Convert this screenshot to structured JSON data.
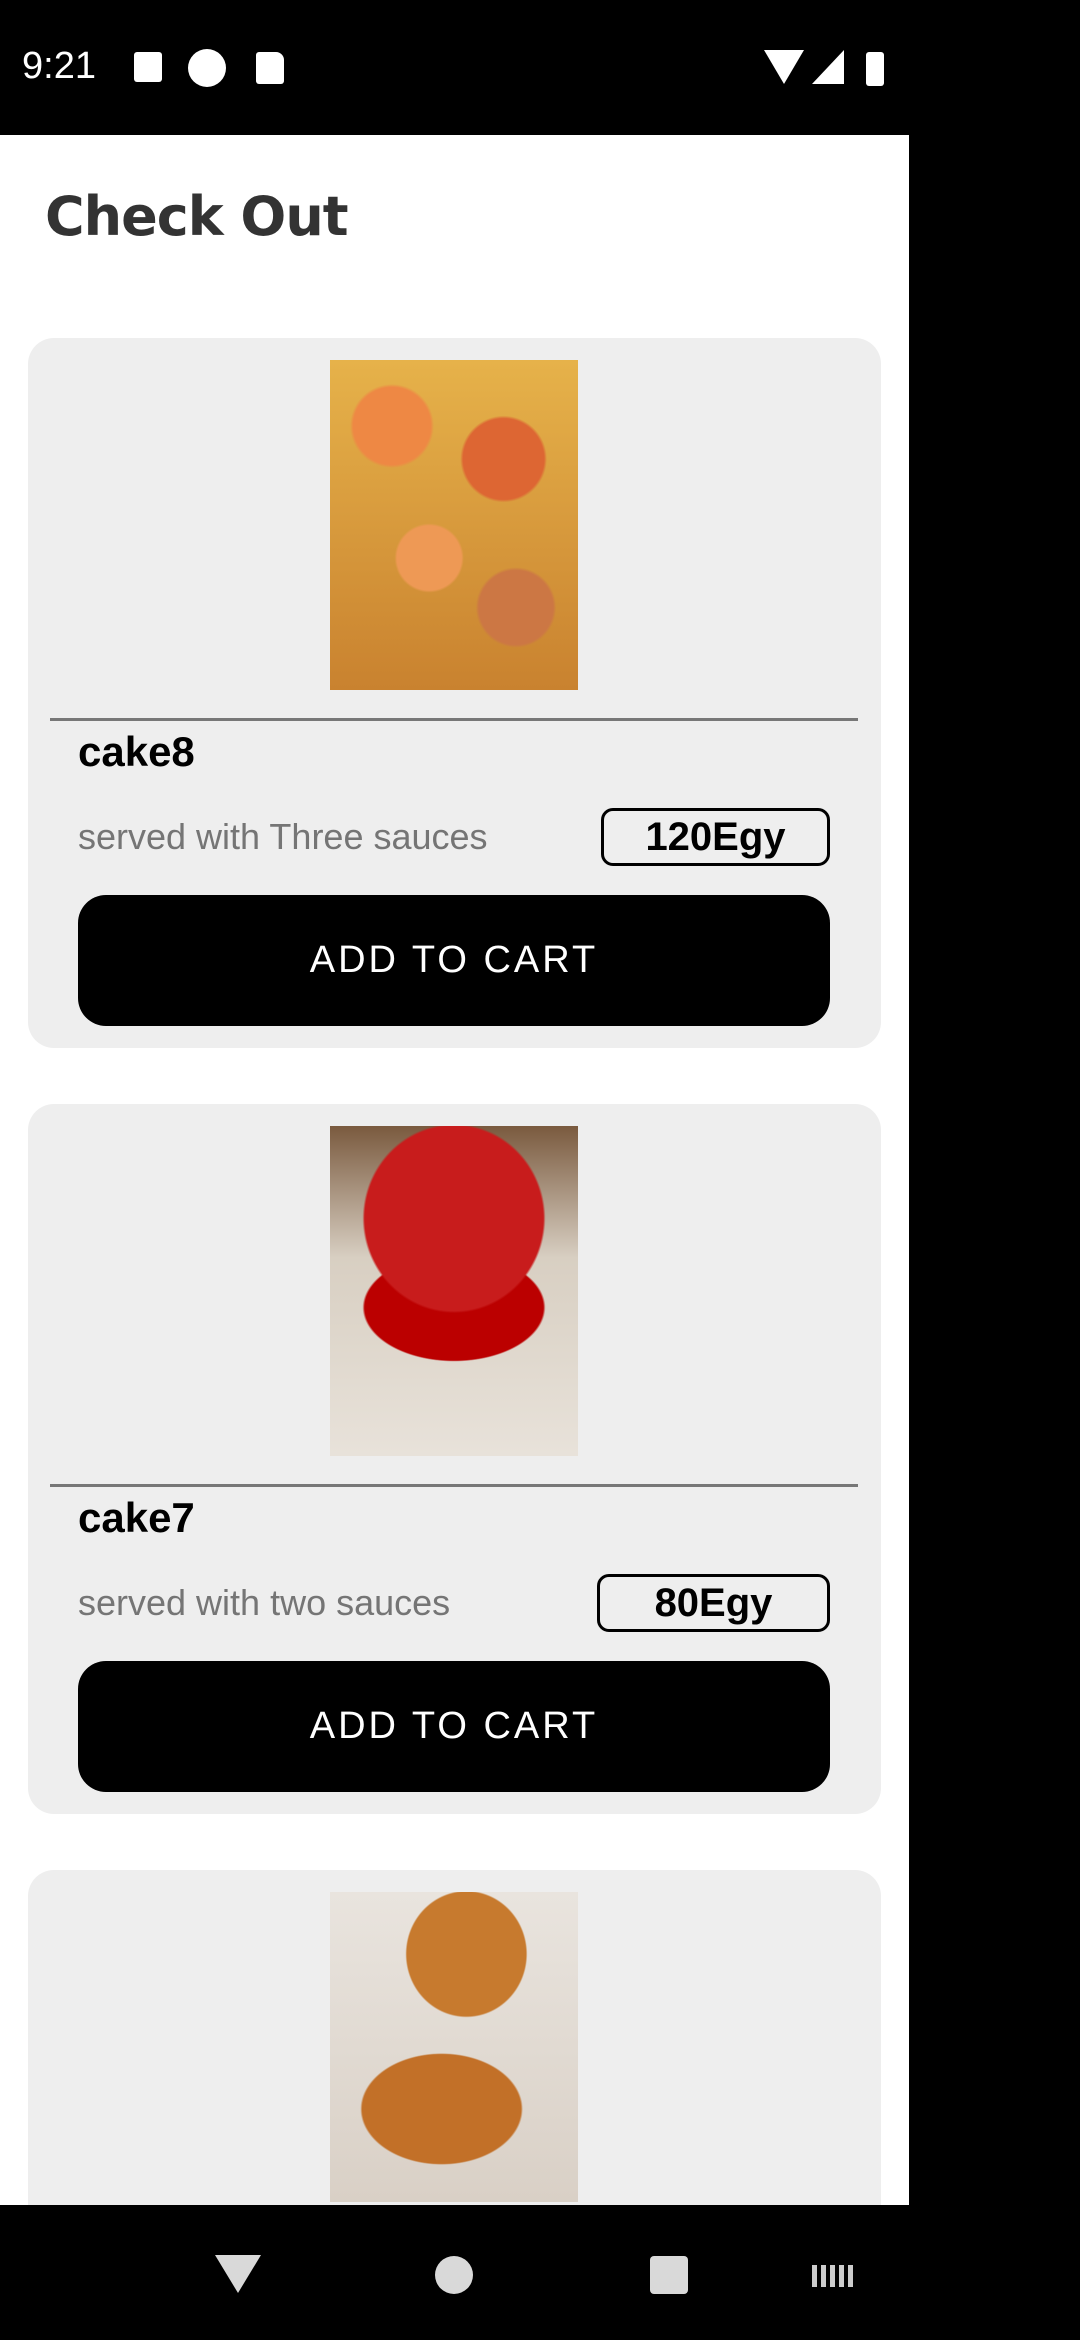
{
  "status_bar": {
    "time": "9:21"
  },
  "header": {
    "title": "Check Out"
  },
  "products": [
    {
      "name": "cake8",
      "description": "served with Three sauces",
      "price": "120Egy",
      "button": "ADD TO CART",
      "image": "pizza-pastries"
    },
    {
      "name": "cake7",
      "description": "served with two sauces",
      "price": "80Egy",
      "button": "ADD TO CART",
      "image": "strawberry-cake"
    },
    {
      "name": "",
      "description": "",
      "price": "",
      "button": "",
      "image": "honey-cake"
    }
  ],
  "colors": {
    "card_bg": "#eeeeee",
    "button_bg": "#000000",
    "title": "#333333",
    "description": "#757575"
  }
}
